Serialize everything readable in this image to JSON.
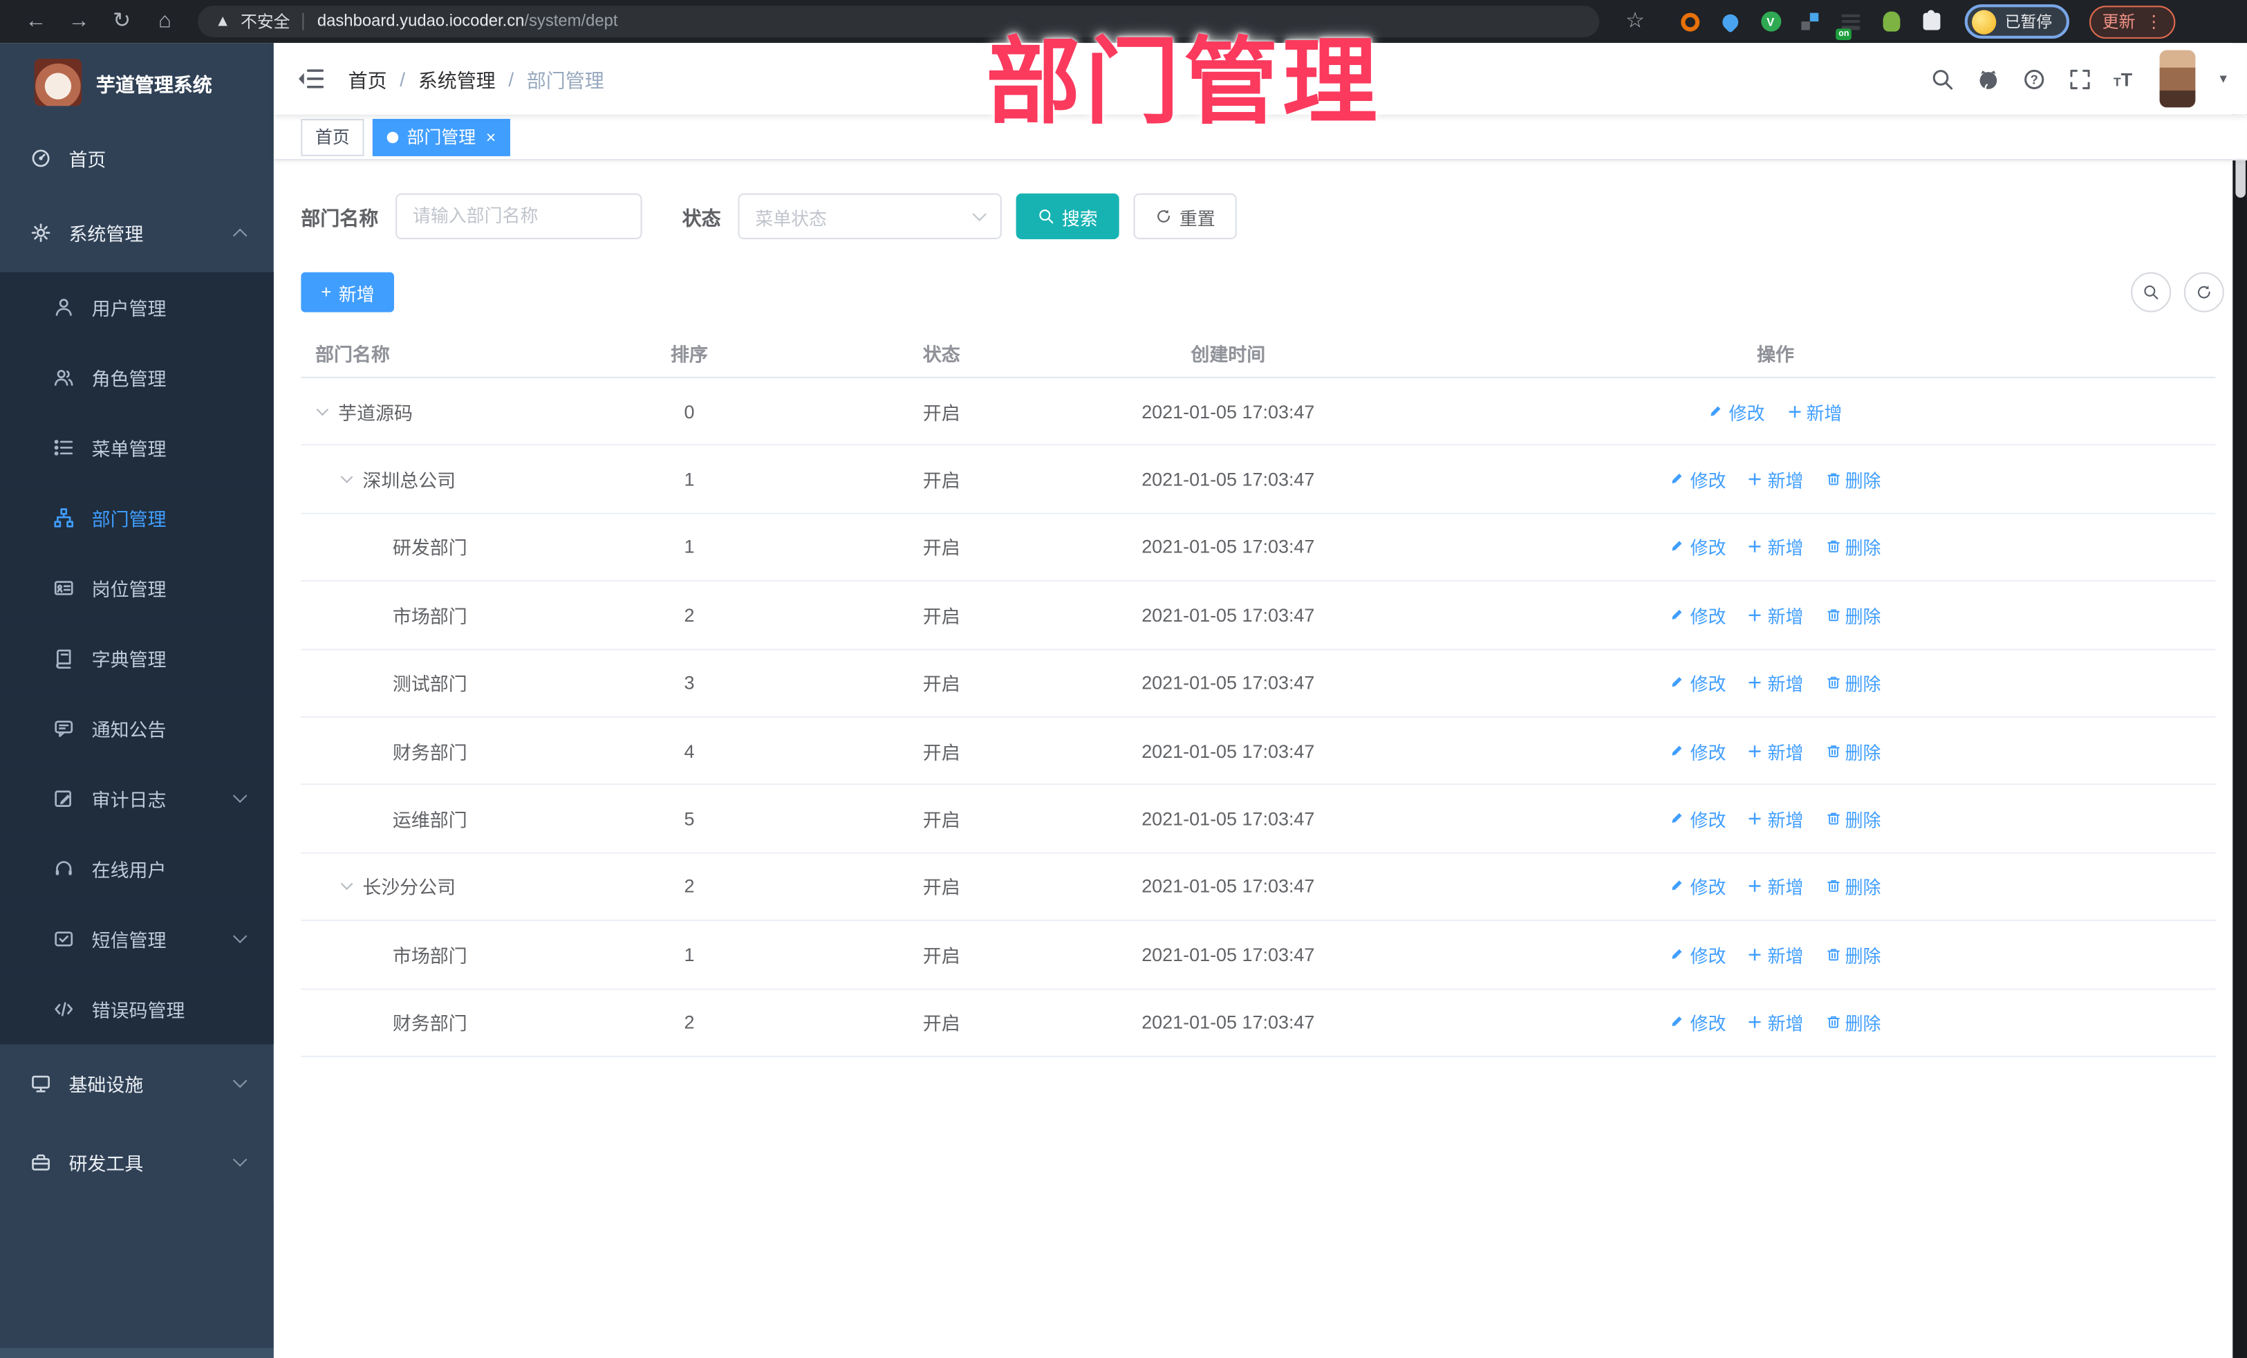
{
  "browser": {
    "security_label": "不安全",
    "url_domain": "dashboard.yudao.iocoder.cn",
    "url_path": "/system/dept",
    "profile_status": "已暂停",
    "update_label": "更新",
    "extensions": [
      {
        "name": "extension-orange-icon"
      },
      {
        "name": "extension-pin-icon"
      },
      {
        "name": "extension-green-icon",
        "letter": "V"
      },
      {
        "name": "extension-squares-icon"
      },
      {
        "name": "extension-grid-on-icon",
        "badge": "on"
      },
      {
        "name": "extension-avatar-icon"
      },
      {
        "name": "extensions-puzzle-icon"
      }
    ]
  },
  "annotation": {
    "text": "部门管理",
    "color": "#fb3a5e"
  },
  "sidebar": {
    "app_title": "芋道管理系统",
    "menu": [
      {
        "label": "首页",
        "icon": "dashboard-icon",
        "level": 0
      },
      {
        "label": "系统管理",
        "icon": "gear-icon",
        "level": 0,
        "chevron": "up",
        "tall": true
      },
      {
        "label": "用户管理",
        "icon": "user-icon",
        "level": 1
      },
      {
        "label": "角色管理",
        "icon": "role-icon",
        "level": 1
      },
      {
        "label": "菜单管理",
        "icon": "menu-icon",
        "level": 1
      },
      {
        "label": "部门管理",
        "icon": "dept-tree-icon",
        "level": 1,
        "active": true
      },
      {
        "label": "岗位管理",
        "icon": "post-icon",
        "level": 1
      },
      {
        "label": "字典管理",
        "icon": "dict-icon",
        "level": 1
      },
      {
        "label": "通知公告",
        "icon": "notice-icon",
        "level": 1
      },
      {
        "label": "审计日志",
        "icon": "audit-icon",
        "level": 1,
        "chevron": "down"
      },
      {
        "label": "在线用户",
        "icon": "online-icon",
        "level": 1
      },
      {
        "label": "短信管理",
        "icon": "sms-icon",
        "level": 1,
        "chevron": "down"
      },
      {
        "label": "错误码管理",
        "icon": "error-code-icon",
        "level": 1
      },
      {
        "label": "基础设施",
        "icon": "infra-icon",
        "level": 0,
        "chevron": "down",
        "tall": true
      },
      {
        "label": "研发工具",
        "icon": "devtools-icon",
        "level": 0,
        "chevron": "down",
        "tall": true
      }
    ]
  },
  "navbar": {
    "breadcrumb": [
      "首页",
      "系统管理",
      "部门管理"
    ]
  },
  "tags": [
    {
      "label": "首页",
      "active": false
    },
    {
      "label": "部门管理",
      "active": true
    }
  ],
  "filter": {
    "dept_label": "部门名称",
    "dept_placeholder": "请输入部门名称",
    "status_label": "状态",
    "status_placeholder": "菜单状态",
    "search_label": "搜索",
    "reset_label": "重置"
  },
  "toolbar": {
    "add_label": "新增"
  },
  "table": {
    "columns": [
      "部门名称",
      "排序",
      "状态",
      "创建时间",
      "操作"
    ],
    "action_labels": {
      "edit": "修改",
      "add": "新增",
      "delete": "删除"
    },
    "rows": [
      {
        "name": "芋道源码",
        "level": 1,
        "expanded": true,
        "sort": "0",
        "status": "开启",
        "created": "2021-01-05 17:03:47",
        "actions": [
          "edit",
          "add"
        ]
      },
      {
        "name": "深圳总公司",
        "level": 2,
        "expanded": true,
        "sort": "1",
        "status": "开启",
        "created": "2021-01-05 17:03:47",
        "actions": [
          "edit",
          "add",
          "delete"
        ]
      },
      {
        "name": "研发部门",
        "level": 3,
        "expanded": false,
        "sort": "1",
        "status": "开启",
        "created": "2021-01-05 17:03:47",
        "actions": [
          "edit",
          "add",
          "delete"
        ]
      },
      {
        "name": "市场部门",
        "level": 3,
        "expanded": false,
        "sort": "2",
        "status": "开启",
        "created": "2021-01-05 17:03:47",
        "actions": [
          "edit",
          "add",
          "delete"
        ]
      },
      {
        "name": "测试部门",
        "level": 3,
        "expanded": false,
        "sort": "3",
        "status": "开启",
        "created": "2021-01-05 17:03:47",
        "actions": [
          "edit",
          "add",
          "delete"
        ]
      },
      {
        "name": "财务部门",
        "level": 3,
        "expanded": false,
        "sort": "4",
        "status": "开启",
        "created": "2021-01-05 17:03:47",
        "actions": [
          "edit",
          "add",
          "delete"
        ]
      },
      {
        "name": "运维部门",
        "level": 3,
        "expanded": false,
        "sort": "5",
        "status": "开启",
        "created": "2021-01-05 17:03:47",
        "actions": [
          "edit",
          "add",
          "delete"
        ]
      },
      {
        "name": "长沙分公司",
        "level": 2,
        "expanded": true,
        "sort": "2",
        "status": "开启",
        "created": "2021-01-05 17:03:47",
        "actions": [
          "edit",
          "add",
          "delete"
        ]
      },
      {
        "name": "市场部门",
        "level": 3,
        "expanded": false,
        "sort": "1",
        "status": "开启",
        "created": "2021-01-05 17:03:47",
        "actions": [
          "edit",
          "add",
          "delete"
        ]
      },
      {
        "name": "财务部门",
        "level": 3,
        "expanded": false,
        "sort": "2",
        "status": "开启",
        "created": "2021-01-05 17:03:47",
        "actions": [
          "edit",
          "add",
          "delete"
        ]
      }
    ]
  }
}
